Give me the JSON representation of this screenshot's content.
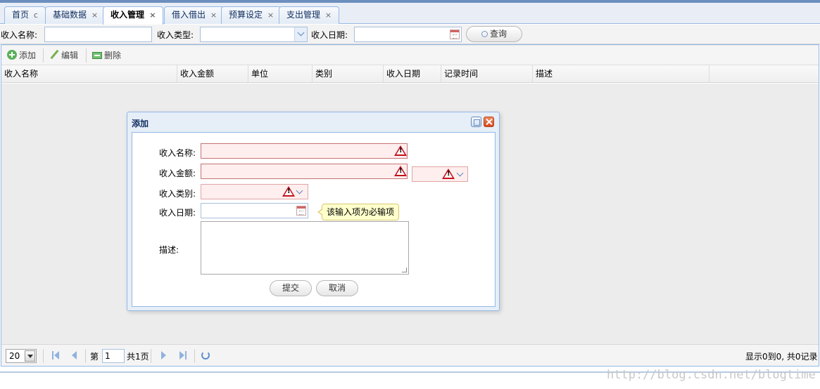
{
  "tabs": [
    {
      "label": "首页",
      "close": "c"
    },
    {
      "label": "基础数据",
      "close": "×"
    },
    {
      "label": "收入管理",
      "close": "×"
    },
    {
      "label": "借入借出",
      "close": "×"
    },
    {
      "label": "预算设定",
      "close": "×"
    },
    {
      "label": "支出管理",
      "close": "×"
    }
  ],
  "search": {
    "name_label": "收入名称:",
    "type_label": "收入类型:",
    "date_label": "收入日期:",
    "query_button": "查询"
  },
  "toolbar": {
    "add": "添加",
    "edit": "编辑",
    "delete": "删除"
  },
  "grid": {
    "columns": [
      "收入名称",
      "收入金额",
      "单位",
      "类别",
      "收入日期",
      "记录时间",
      "描述"
    ]
  },
  "pager": {
    "page_size": "20",
    "page_prefix": "第",
    "page_number": "1",
    "total_pages": "共1页",
    "summary": "显示0到0, 共0记录"
  },
  "dialog": {
    "title": "添加",
    "name_label": "收入名称:",
    "amount_label": "收入金额:",
    "type_label": "收入类别:",
    "date_label": "收入日期:",
    "desc_label": "描述:",
    "tooltip": "该输入项为必输项",
    "submit": "提交",
    "cancel": "取消"
  },
  "watermark": "http://blog.csdn.net/blogtime",
  "colors": {
    "accent_border": "#95b8e7",
    "invalid_bg": "#ffeeee",
    "warning": "#c4121c",
    "tooltip_bg": "#ffffcc"
  }
}
